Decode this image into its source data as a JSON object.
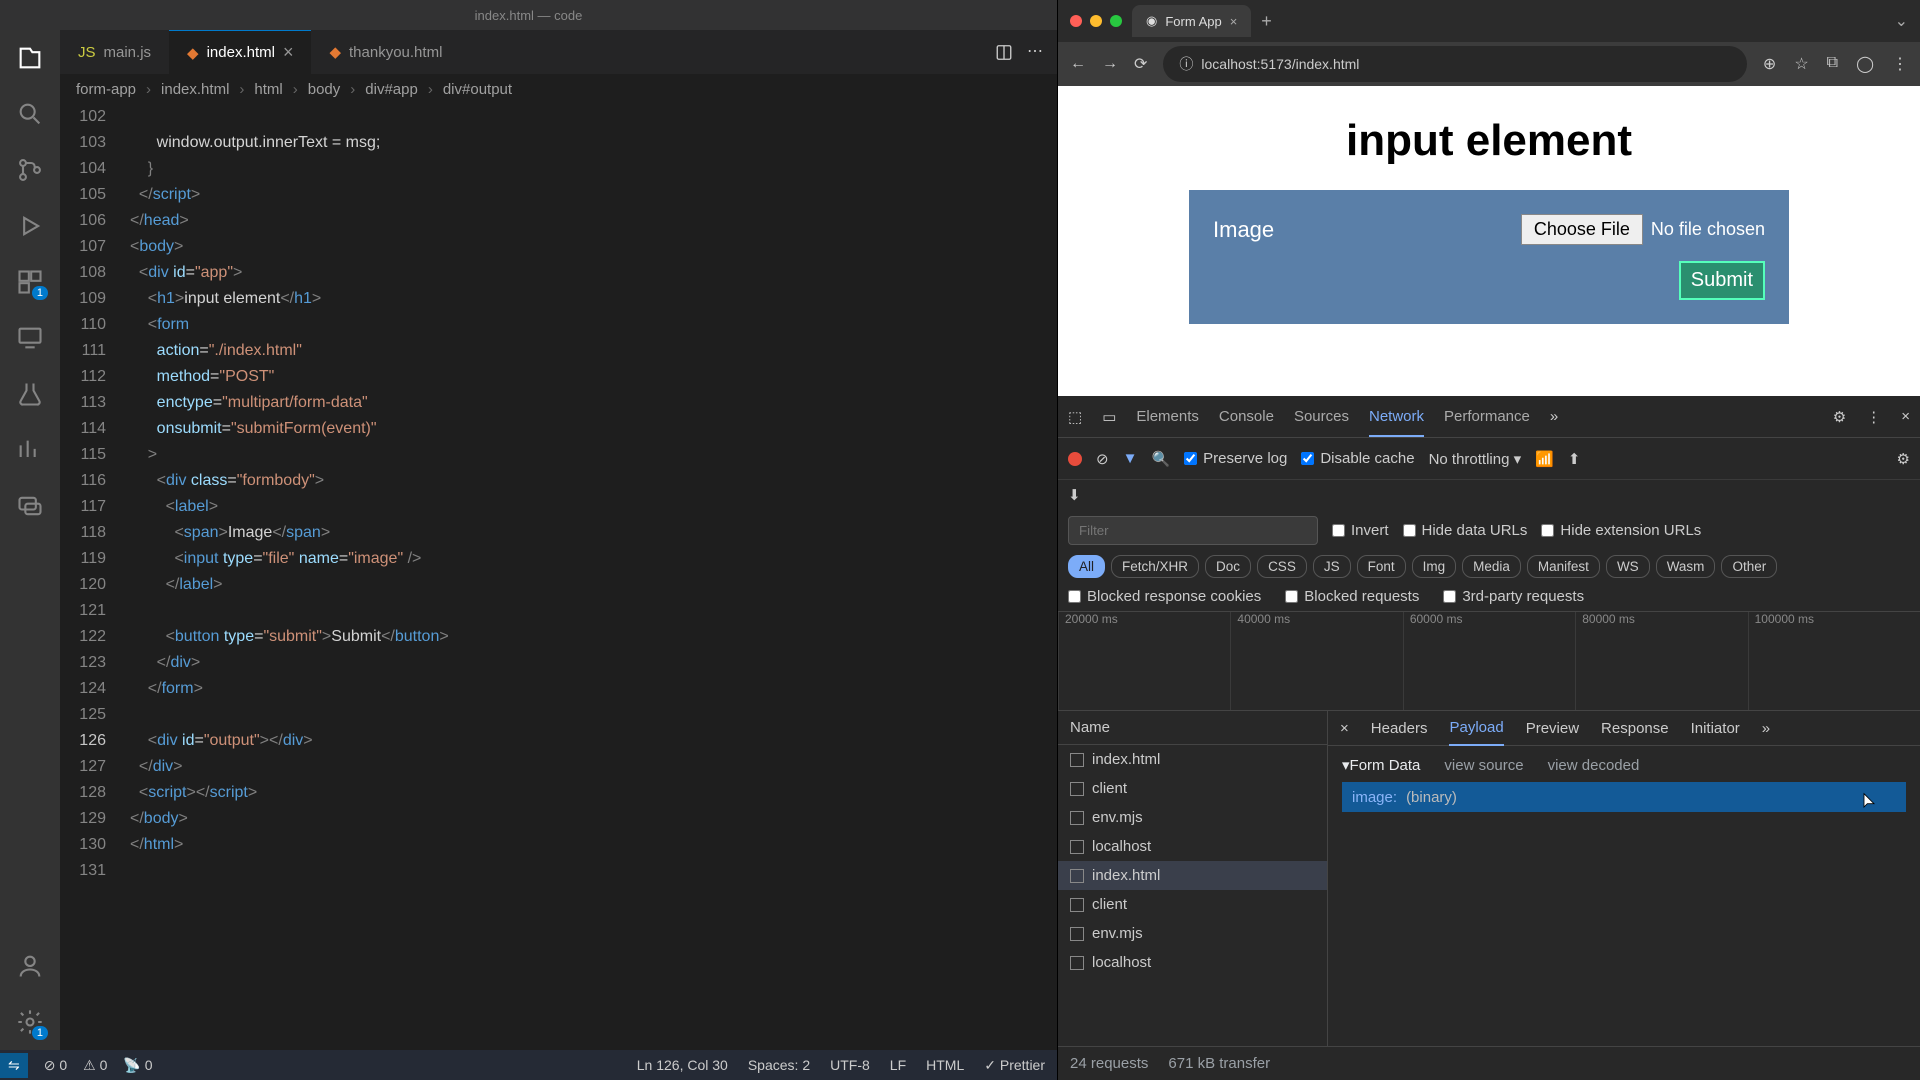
{
  "vscode": {
    "title": "index.html — code",
    "tabs": [
      {
        "icon": "js",
        "label": "main.js"
      },
      {
        "icon": "html",
        "label": "index.html",
        "active": true
      },
      {
        "icon": "html",
        "label": "thankyou.html"
      }
    ],
    "breadcrumbs": [
      "form-app",
      "index.html",
      "html",
      "body",
      "div#app",
      "div#output"
    ],
    "lines": [
      "102",
      "103",
      "104",
      "105",
      "106",
      "107",
      "108",
      "109",
      "110",
      "111",
      "112",
      "113",
      "114",
      "115",
      "116",
      "117",
      "118",
      "119",
      "120",
      "121",
      "122",
      "123",
      "124",
      "125",
      "126",
      "127",
      "128",
      "129",
      "130",
      "131"
    ],
    "current_line": "126",
    "code": {
      "l103": "      window.output.innerText = msg;",
      "l109_text": "input element",
      "l111_action": "./index.html",
      "l112_method": "POST",
      "l113_enctype": "multipart/form-data",
      "l114_onsubmit": "submitForm(event)",
      "l116_class": "formbody",
      "l118_span": "Image",
      "l119_type": "file",
      "l119_name": "image",
      "l122_type": "submit",
      "l122_text": "Submit",
      "l126_id": "output"
    },
    "status": {
      "errors": "0",
      "warnings": "0",
      "ports": "0",
      "cursor": "Ln 126, Col 30",
      "spaces": "Spaces: 2",
      "encoding": "UTF-8",
      "eol": "LF",
      "lang": "HTML",
      "formatter": "Prettier"
    },
    "ext_badge": "1",
    "gear_badge": "1"
  },
  "browser": {
    "tab_label": "Form App",
    "url": "localhost:5173/index.html",
    "page": {
      "heading": "input element",
      "field_label": "Image",
      "choose_file": "Choose File",
      "no_file": "No file chosen",
      "submit": "Submit"
    }
  },
  "devtools": {
    "tabs": [
      "Elements",
      "Console",
      "Sources",
      "Network",
      "Performance"
    ],
    "active_tab": "Network",
    "preserve_log": "Preserve log",
    "disable_cache": "Disable cache",
    "throttling": "No throttling",
    "filter_placeholder": "Filter",
    "invert": "Invert",
    "hide_data_urls": "Hide data URLs",
    "hide_ext_urls": "Hide extension URLs",
    "pills": [
      "All",
      "Fetch/XHR",
      "Doc",
      "CSS",
      "JS",
      "Font",
      "Img",
      "Media",
      "Manifest",
      "WS",
      "Wasm",
      "Other"
    ],
    "active_pill": "All",
    "blocked_cookies": "Blocked response cookies",
    "blocked_requests": "Blocked requests",
    "third_party": "3rd-party requests",
    "timeline_ticks": [
      "20000 ms",
      "40000 ms",
      "60000 ms",
      "80000 ms",
      "100000 ms"
    ],
    "name_header": "Name",
    "requests": [
      "index.html",
      "client",
      "env.mjs",
      "localhost",
      "index.html",
      "client",
      "env.mjs",
      "localhost"
    ],
    "selected_index": 4,
    "detail_tabs": [
      "Headers",
      "Payload",
      "Preview",
      "Response",
      "Initiator"
    ],
    "active_detail": "Payload",
    "formdata_title": "Form Data",
    "view_source": "view source",
    "view_decoded": "view decoded",
    "fd_key": "image:",
    "fd_val": "(binary)",
    "status_requests": "24 requests",
    "status_transfer": "671 kB transfer"
  }
}
